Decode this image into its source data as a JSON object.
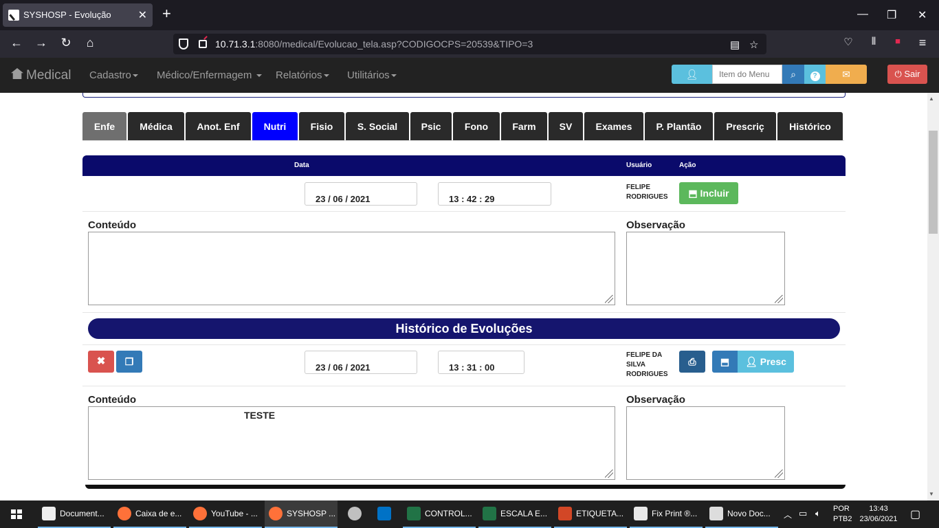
{
  "browser": {
    "tab_title": "SYSHOSP - Evolução",
    "url_host": "10.71.3.1",
    "url_rest": ":8080/medical/Evolucao_tela.asp?CODIGOCPS=20539&TIPO=3"
  },
  "app": {
    "brand": "Medical",
    "menus": [
      "Cadastro",
      "Médico/Enfermagem",
      "Relatórios",
      "Utilitários"
    ],
    "search_placeholder": "Item do Menu",
    "logout_label": "Sair"
  },
  "tabs": [
    "Enfe",
    "Médica",
    "Anot. Enf",
    "Nutri",
    "Fisio",
    "S. Social",
    "Psic",
    "Fono",
    "Farm",
    "SV",
    "Exames",
    "P. Plantão",
    "Prescriç",
    "Histórico"
  ],
  "form": {
    "header_data": "Data",
    "header_usuario": "Usuário",
    "header_acao": "Ação",
    "date": "23 / 06 / 2021",
    "time": "13 : 42 : 29",
    "user_line1": "FELIPE",
    "user_line2": "RODRIGUES",
    "include_label": "Incluir",
    "conteudo_label": "Conteúdo",
    "observacao_label": "Observação"
  },
  "history": {
    "title": "Histórico de Evoluções",
    "date": "23 / 06 / 2021",
    "time": "13 : 31 : 00",
    "user_line1": "FELIPE DA",
    "user_line2": "SILVA",
    "user_line3": "RODRIGUES",
    "presc_label": "Presc",
    "conteudo_label": "Conteúdo",
    "conteudo_value": "TESTE",
    "observacao_label": "Observação"
  },
  "taskbar": {
    "items": [
      "Document...",
      "Caixa de e...",
      "YouTube - ...",
      "SYSHOSP ...",
      "CONTROL...",
      "ESCALA E...",
      "ETIQUETA...",
      "Fix Print ®...",
      "Novo Doc..."
    ],
    "lang1": "POR",
    "lang2": "PTB2",
    "time": "13:43",
    "date": "23/06/2021"
  },
  "colors": {
    "tab_blue": "#0000ff",
    "header_navy": "#0a0a6b",
    "include_green": "#5cb85c",
    "delete_red": "#d9534f",
    "logout_red": "#d9534f"
  }
}
